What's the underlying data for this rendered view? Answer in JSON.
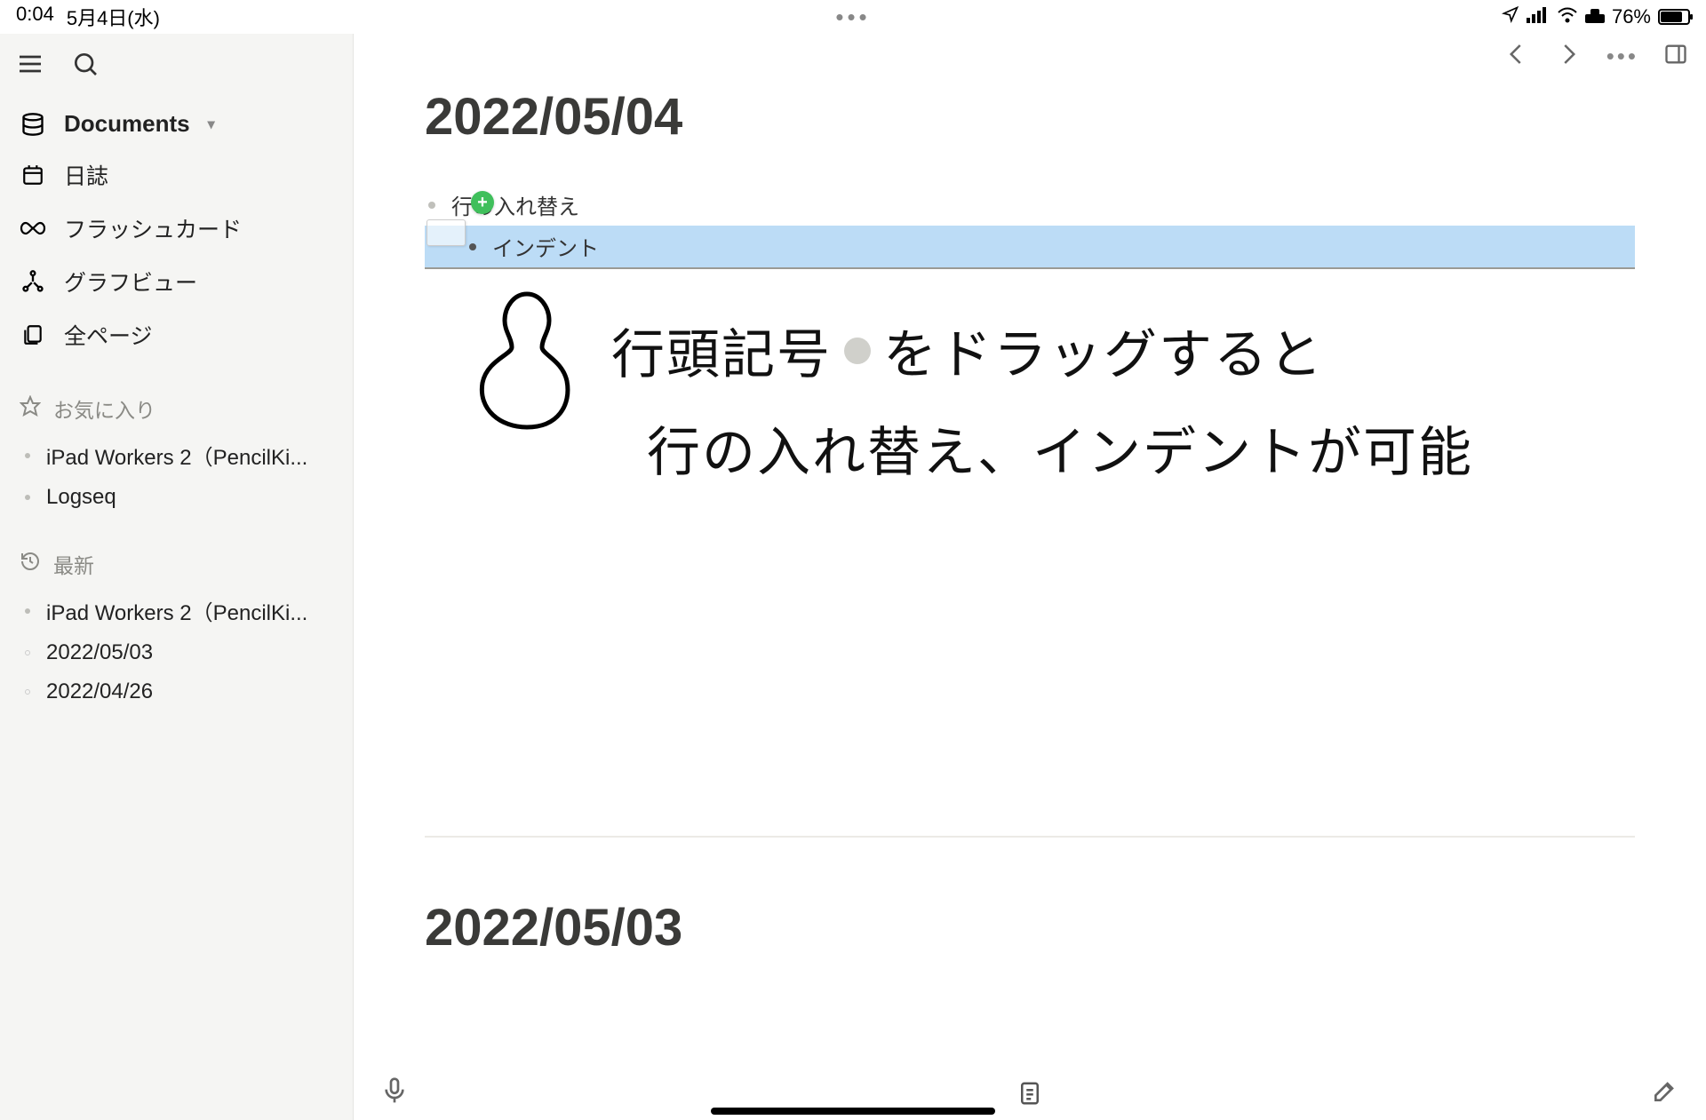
{
  "status": {
    "time": "0:04",
    "date": "5月4日(水)",
    "battery_pct": "76%"
  },
  "toolbar": {
    "nav_back": "←",
    "nav_fwd": "→"
  },
  "sidebar": {
    "documents_label": "Documents",
    "nav": [
      {
        "label": "日誌",
        "icon": "calendar-icon"
      },
      {
        "label": "フラッシュカード",
        "icon": "infinity-icon"
      },
      {
        "label": "グラフビュー",
        "icon": "graph-icon"
      },
      {
        "label": "全ページ",
        "icon": "pages-icon"
      }
    ],
    "favorites_header": "お気に入り",
    "favorites": [
      {
        "label": "iPad Workers 2（PencilKi..."
      },
      {
        "label": "Logseq"
      }
    ],
    "recent_header": "最新",
    "recent": [
      {
        "label": "iPad Workers 2（PencilKi..."
      },
      {
        "label": "2022/05/03"
      },
      {
        "label": "2022/04/26"
      }
    ]
  },
  "page": {
    "title": "2022/05/04",
    "bullet1": "行の入れ替え",
    "bullet2": "インデント",
    "handwriting_line1_a": "行頭記号",
    "handwriting_line1_b": "をドラッグすると",
    "handwriting_line2": "行の入れ替え、インデントが可能",
    "title2": "2022/05/03"
  }
}
